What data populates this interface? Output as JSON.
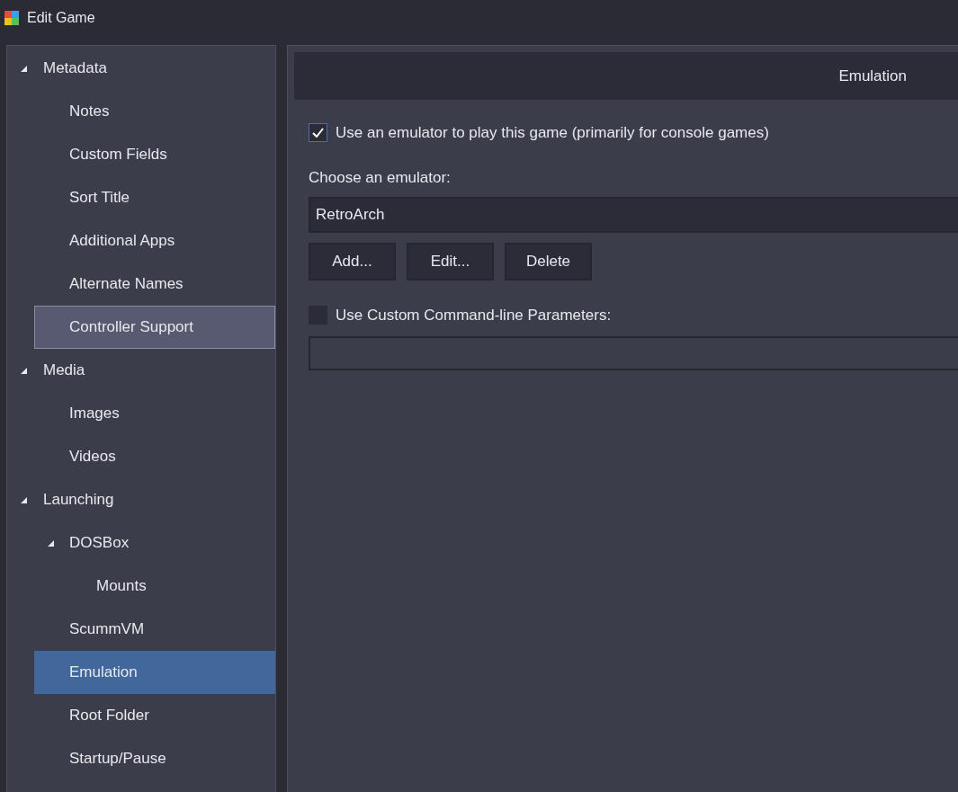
{
  "window": {
    "title": "Edit Game"
  },
  "sidebar": {
    "items": [
      {
        "label": "Metadata",
        "expanded": true,
        "selected": false,
        "hovered": false,
        "children": [
          {
            "label": "Notes",
            "selected": false,
            "hovered": false
          },
          {
            "label": "Custom Fields",
            "selected": false,
            "hovered": false
          },
          {
            "label": "Sort Title",
            "selected": false,
            "hovered": false
          },
          {
            "label": "Additional Apps",
            "selected": false,
            "hovered": false
          },
          {
            "label": "Alternate Names",
            "selected": false,
            "hovered": false
          },
          {
            "label": "Controller Support",
            "selected": false,
            "hovered": true
          }
        ]
      },
      {
        "label": "Media",
        "expanded": true,
        "selected": false,
        "hovered": false,
        "children": [
          {
            "label": "Images",
            "selected": false,
            "hovered": false
          },
          {
            "label": "Videos",
            "selected": false,
            "hovered": false
          }
        ]
      },
      {
        "label": "Launching",
        "expanded": true,
        "selected": false,
        "hovered": false,
        "children": [
          {
            "label": "DOSBox",
            "expanded": true,
            "selected": false,
            "hovered": false,
            "children": [
              {
                "label": "Mounts",
                "selected": false,
                "hovered": false
              }
            ]
          },
          {
            "label": "ScummVM",
            "selected": false,
            "hovered": false
          },
          {
            "label": "Emulation",
            "selected": true,
            "hovered": false
          },
          {
            "label": "Root Folder",
            "selected": false,
            "hovered": false
          },
          {
            "label": "Startup/Pause",
            "selected": false,
            "hovered": false
          }
        ]
      }
    ]
  },
  "panel": {
    "title": "Emulation",
    "use_emulator": {
      "label": "Use an emulator to play this game (primarily for console games)",
      "checked": true
    },
    "emulator_label": "Choose an emulator:",
    "emulator": {
      "value": "RetroArch"
    },
    "buttons": [
      "Add...",
      "Edit...",
      "Delete"
    ],
    "custom_params": {
      "label": "Use Custom Command-line Parameters:",
      "checked": false
    }
  }
}
